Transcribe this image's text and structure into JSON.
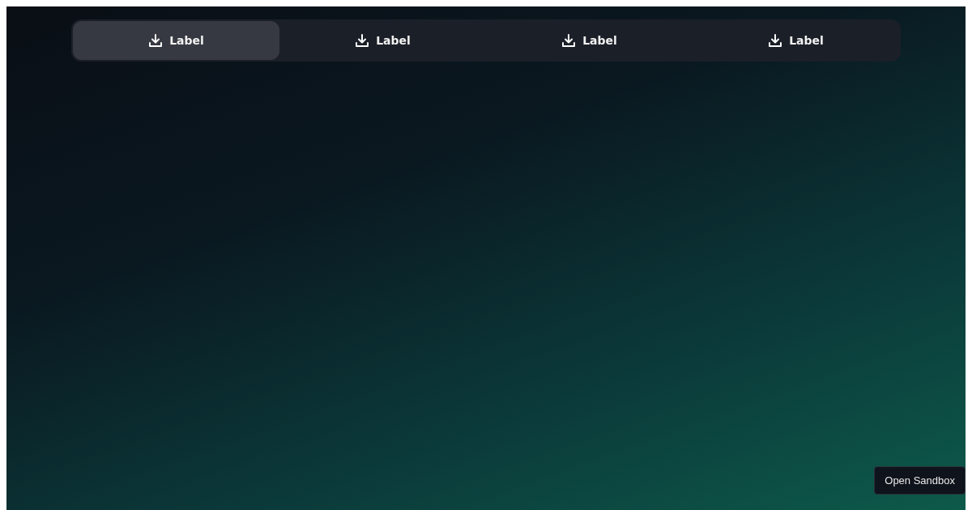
{
  "tabs": [
    {
      "label": "Label",
      "selected": true
    },
    {
      "label": "Label",
      "selected": false
    },
    {
      "label": "Label",
      "selected": false
    },
    {
      "label": "Label",
      "selected": false
    }
  ],
  "sandbox_button": {
    "label": "Open Sandbox"
  }
}
